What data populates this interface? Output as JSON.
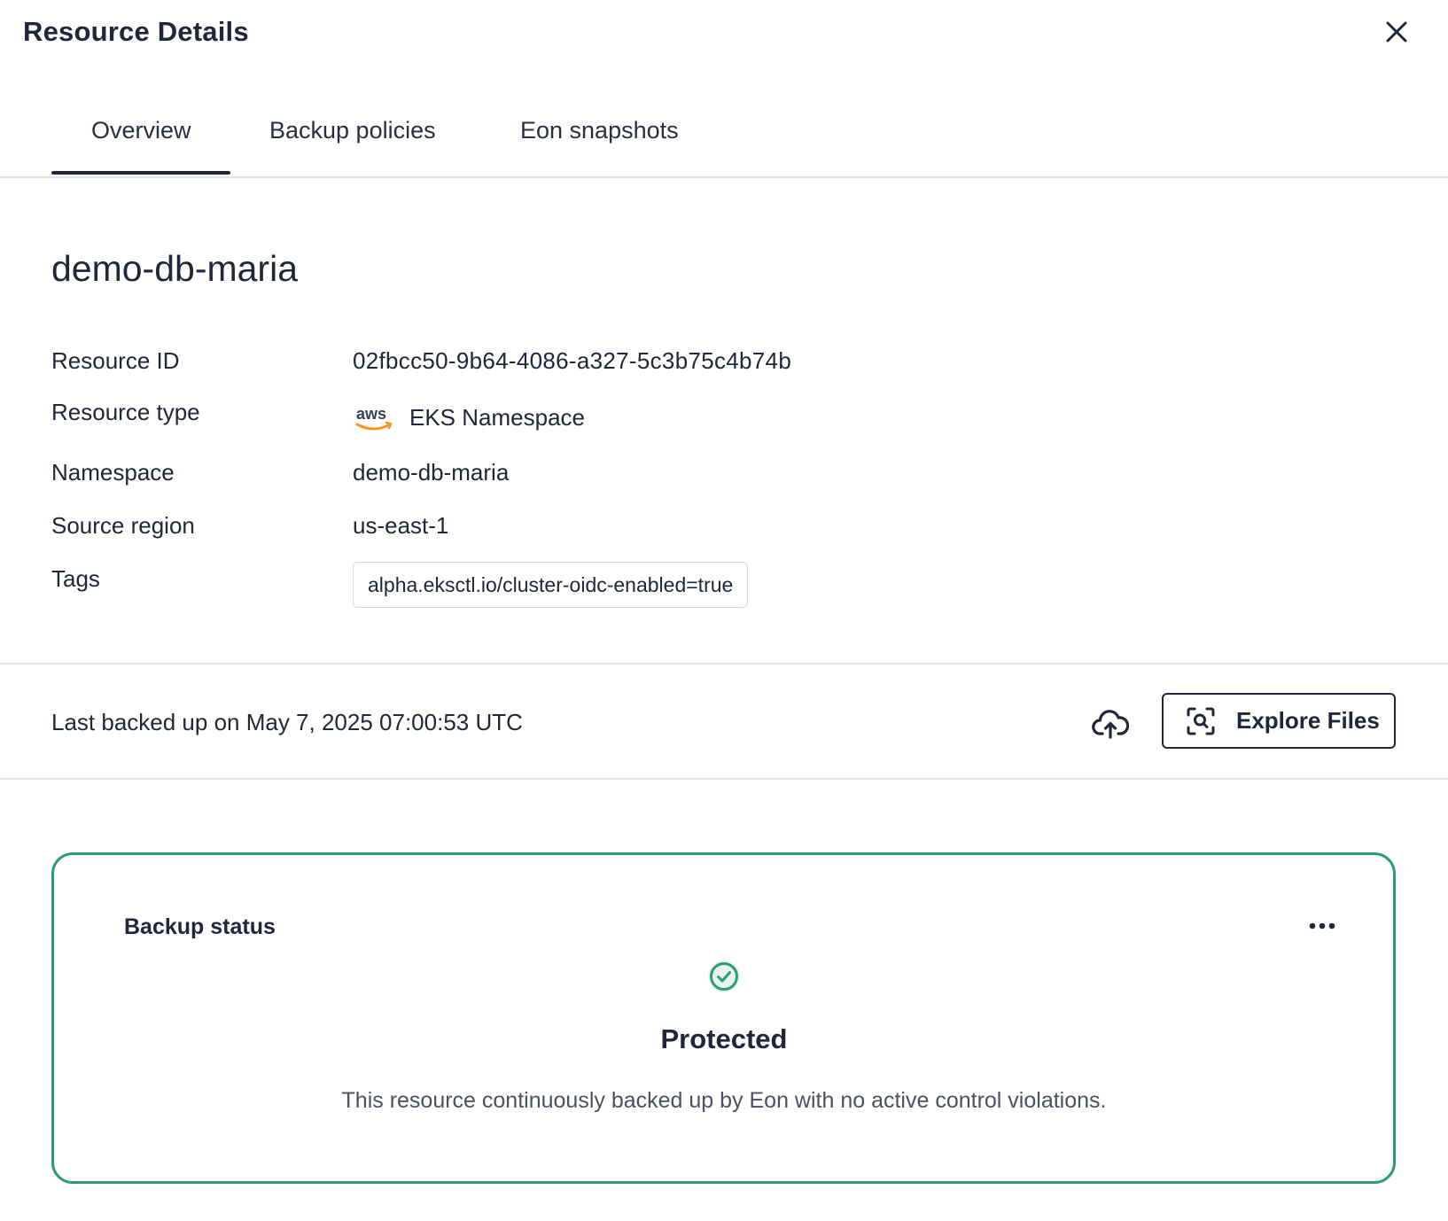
{
  "header": {
    "title": "Resource Details",
    "close_icon": "close-icon"
  },
  "tabs": [
    {
      "label": "Overview",
      "active": true
    },
    {
      "label": "Backup policies",
      "active": false
    },
    {
      "label": "Eon snapshots",
      "active": false
    }
  ],
  "resource": {
    "name": "demo-db-maria",
    "fields": {
      "resource_id_label": "Resource ID",
      "resource_id_value": "02fbcc50-9b64-4086-a327-5c3b75c4b74b",
      "resource_type_label": "Resource type",
      "resource_type_logo_text": "aws",
      "resource_type_value": "EKS Namespace",
      "namespace_label": "Namespace",
      "namespace_value": "demo-db-maria",
      "source_region_label": "Source region",
      "source_region_value": "us-east-1",
      "tags_label": "Tags",
      "tags": [
        "alpha.eksctl.io/cluster-oidc-enabled=true"
      ]
    }
  },
  "backup_row": {
    "last_backed_up": "Last backed up on May 7, 2025 07:00:53 UTC",
    "cloud_icon": "cloud-upload-icon",
    "explore_icon": "file-search-icon",
    "explore_label": "Explore Files"
  },
  "status_card": {
    "title": "Backup status",
    "more_icon": "more-horizontal-icon",
    "status_icon": "check-circle-icon",
    "status": "Protected",
    "description": "This resource continuously backed up by Eon with no active control violations.",
    "accent_color": "#2d9a78"
  }
}
